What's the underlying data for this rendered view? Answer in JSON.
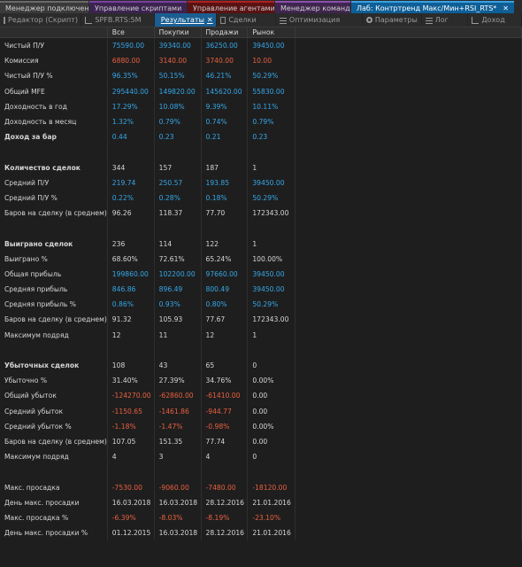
{
  "top_tabs": [
    {
      "label": "Менеджер подключений",
      "style": "t-gray"
    },
    {
      "label": "Управление скриптами",
      "style": "t-purple"
    },
    {
      "label": "Управление агентами",
      "style": "t-red"
    },
    {
      "label": "Менеджер команд",
      "style": "t-violet"
    },
    {
      "label": "Лаб: Контртренд Макс/Мин+RSI_RTS*",
      "style": "t-active",
      "close": "✕"
    }
  ],
  "sub_tabs": [
    {
      "label": "Редактор (Скрипт)",
      "icon": "doc",
      "name": "tab-editor"
    },
    {
      "label": "SPFB.RTS:5M",
      "icon": "chart",
      "name": "tab-chart"
    },
    {
      "label": "Результаты",
      "icon": "grid",
      "name": "tab-results",
      "active": true,
      "close": "✕"
    },
    {
      "label": "Сделки",
      "icon": "doc",
      "name": "tab-trades"
    },
    {
      "label": "Оптимизация",
      "icon": "list",
      "name": "tab-optimization"
    },
    {
      "label": "Параметры",
      "icon": "gear",
      "name": "tab-parameters"
    },
    {
      "label": "Лог",
      "icon": "list",
      "name": "tab-log"
    },
    {
      "label": "Доход",
      "icon": "chart",
      "name": "tab-income"
    }
  ],
  "columns": [
    "",
    "Все",
    "Покупки",
    "Продажи",
    "Рынок"
  ],
  "rows": [
    {
      "label": "Чистый П/У",
      "values": [
        "75590.00",
        "39340.00",
        "36250.00",
        "39450.00"
      ],
      "colors": [
        "blue",
        "blue",
        "blue",
        "blue"
      ]
    },
    {
      "label": "Комиссия",
      "values": [
        "6880.00",
        "3140.00",
        "3740.00",
        "10.00"
      ],
      "colors": [
        "red",
        "red",
        "red",
        "red"
      ]
    },
    {
      "label": "Чистый П/У %",
      "values": [
        "96.35%",
        "50.15%",
        "46.21%",
        "50.29%"
      ],
      "colors": [
        "blue",
        "blue",
        "blue",
        "blue"
      ]
    },
    {
      "label": "Общий MFE",
      "values": [
        "295440.00",
        "149820.00",
        "145620.00",
        "55830.00"
      ],
      "colors": [
        "blue",
        "blue",
        "blue",
        "blue"
      ]
    },
    {
      "label": "Доходность в год",
      "values": [
        "17.29%",
        "10.08%",
        "9.39%",
        "10.11%"
      ],
      "colors": [
        "blue",
        "blue",
        "blue",
        "blue"
      ]
    },
    {
      "label": "Доходность в месяц",
      "values": [
        "1.32%",
        "0.79%",
        "0.74%",
        "0.79%"
      ],
      "colors": [
        "blue",
        "blue",
        "blue",
        "blue"
      ]
    },
    {
      "label": "Доход за бар",
      "values": [
        "0.44",
        "0.23",
        "0.21",
        "0.23"
      ],
      "colors": [
        "blue",
        "blue",
        "blue",
        "blue"
      ],
      "bold": true
    },
    {
      "blank": true
    },
    {
      "label": "Количество сделок",
      "values": [
        "344",
        "157",
        "187",
        "1"
      ],
      "colors": [
        "plain",
        "plain",
        "plain",
        "plain"
      ],
      "bold": true
    },
    {
      "label": "Средний П/У",
      "values": [
        "219.74",
        "250.57",
        "193.85",
        "39450.00"
      ],
      "colors": [
        "blue",
        "blue",
        "blue",
        "blue"
      ]
    },
    {
      "label": "Средний П/У %",
      "values": [
        "0.22%",
        "0.28%",
        "0.18%",
        "50.29%"
      ],
      "colors": [
        "blue",
        "blue",
        "blue",
        "blue"
      ]
    },
    {
      "label": "Баров на сделку (в среднем)",
      "values": [
        "96.26",
        "118.37",
        "77.70",
        "172343.00"
      ],
      "colors": [
        "plain",
        "plain",
        "plain",
        "plain"
      ]
    },
    {
      "blank": true
    },
    {
      "label": "Выиграно сделок",
      "values": [
        "236",
        "114",
        "122",
        "1"
      ],
      "colors": [
        "plain",
        "plain",
        "plain",
        "plain"
      ],
      "bold": true
    },
    {
      "label": "Выиграно %",
      "values": [
        "68.60%",
        "72.61%",
        "65.24%",
        "100.00%"
      ],
      "colors": [
        "plain",
        "plain",
        "plain",
        "plain"
      ]
    },
    {
      "label": "Общая прибыль",
      "values": [
        "199860.00",
        "102200.00",
        "97660.00",
        "39450.00"
      ],
      "colors": [
        "blue",
        "blue",
        "blue",
        "blue"
      ]
    },
    {
      "label": "Средняя прибыль",
      "values": [
        "846.86",
        "896.49",
        "800.49",
        "39450.00"
      ],
      "colors": [
        "blue",
        "blue",
        "blue",
        "blue"
      ]
    },
    {
      "label": "Средняя прибыль %",
      "values": [
        "0.86%",
        "0.93%",
        "0.80%",
        "50.29%"
      ],
      "colors": [
        "blue",
        "blue",
        "blue",
        "blue"
      ]
    },
    {
      "label": "Баров на сделку (в среднем)",
      "values": [
        "91.32",
        "105.93",
        "77.67",
        "172343.00"
      ],
      "colors": [
        "plain",
        "plain",
        "plain",
        "plain"
      ]
    },
    {
      "label": "Максимум подряд",
      "values": [
        "12",
        "11",
        "12",
        "1"
      ],
      "colors": [
        "plain",
        "plain",
        "plain",
        "plain"
      ]
    },
    {
      "blank": true
    },
    {
      "label": "Убыточных сделок",
      "values": [
        "108",
        "43",
        "65",
        "0"
      ],
      "colors": [
        "plain",
        "plain",
        "plain",
        "plain"
      ],
      "bold": true
    },
    {
      "label": "Убыточно %",
      "values": [
        "31.40%",
        "27.39%",
        "34.76%",
        "0.00%"
      ],
      "colors": [
        "plain",
        "plain",
        "plain",
        "plain"
      ]
    },
    {
      "label": "Общий убыток",
      "values": [
        "-124270.00",
        "-62860.00",
        "-61410.00",
        "0.00"
      ],
      "colors": [
        "red",
        "red",
        "red",
        "plain"
      ]
    },
    {
      "label": "Средний убыток",
      "values": [
        "-1150.65",
        "-1461.86",
        "-944.77",
        "0.00"
      ],
      "colors": [
        "red",
        "red",
        "red",
        "plain"
      ]
    },
    {
      "label": "Средний убыток %",
      "values": [
        "-1.18%",
        "-1.47%",
        "-0.98%",
        "0.00%"
      ],
      "colors": [
        "red",
        "red",
        "red",
        "plain"
      ]
    },
    {
      "label": "Баров на сделку (в среднем)",
      "values": [
        "107.05",
        "151.35",
        "77.74",
        "0.00"
      ],
      "colors": [
        "plain",
        "plain",
        "plain",
        "plain"
      ]
    },
    {
      "label": "Максимум подряд",
      "values": [
        "4",
        "3",
        "4",
        "0"
      ],
      "colors": [
        "plain",
        "plain",
        "plain",
        "plain"
      ]
    },
    {
      "blank": true
    },
    {
      "label": "Макс. просадка",
      "values": [
        "-7530.00",
        "-9060.00",
        "-7480.00",
        "-18120.00"
      ],
      "colors": [
        "red",
        "red",
        "red",
        "red"
      ]
    },
    {
      "label": "День макс. просадки",
      "values": [
        "16.03.2018",
        "16.03.2018",
        "28.12.2016",
        "21.01.2016"
      ],
      "colors": [
        "plain",
        "plain",
        "plain",
        "plain"
      ]
    },
    {
      "label": "Макс. просадка %",
      "values": [
        "-6.39%",
        "-8.03%",
        "-8.19%",
        "-23.10%"
      ],
      "colors": [
        "red",
        "red",
        "red",
        "red"
      ]
    },
    {
      "label": "День макс. просадки %",
      "values": [
        "01.12.2015",
        "16.03.2018",
        "28.12.2016",
        "21.01.2016"
      ],
      "colors": [
        "plain",
        "plain",
        "plain",
        "plain"
      ]
    }
  ],
  "colors": {
    "blue": "#35a7e8",
    "red": "#e8603f",
    "accent": "#0e5f97"
  }
}
